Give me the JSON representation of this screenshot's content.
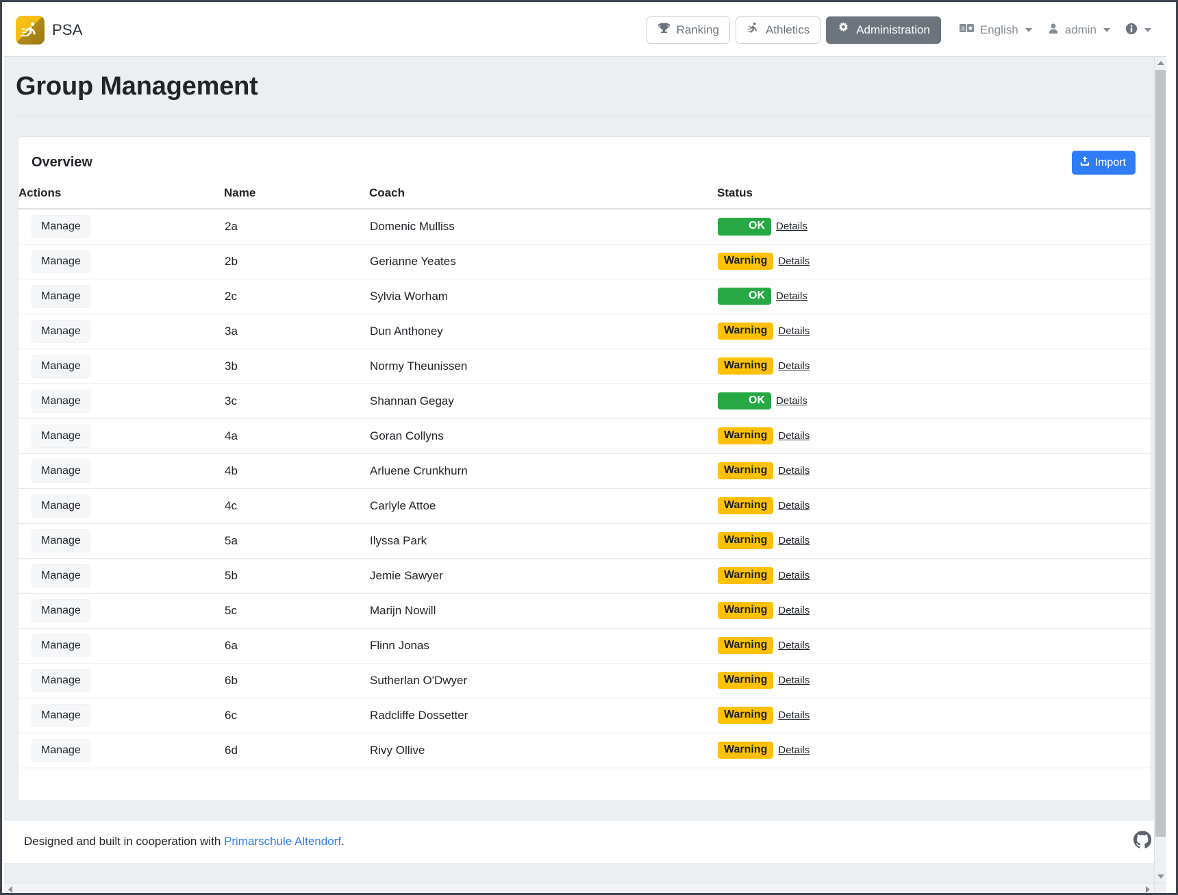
{
  "navbar": {
    "brand": "PSA",
    "brand_logo_icon": "runner-logo-icon",
    "primary_buttons": [
      {
        "label": "Ranking",
        "icon": "trophy-icon",
        "active": false
      },
      {
        "label": "Athletics",
        "icon": "runner-icon",
        "active": false
      },
      {
        "label": "Administration",
        "icon": "gear-icon",
        "active": true
      }
    ],
    "utilities": [
      {
        "label": "English",
        "icon": "translate-icon"
      },
      {
        "label": "admin",
        "icon": "person-icon"
      },
      {
        "label": "",
        "icon": "info-icon"
      }
    ]
  },
  "page": {
    "title": "Group Management"
  },
  "card": {
    "title": "Overview",
    "import_label": "Import",
    "import_icon": "upload-icon"
  },
  "table": {
    "columns": [
      "Actions",
      "Name",
      "Coach",
      "Status"
    ],
    "action_label": "Manage",
    "details_label": "Details",
    "rows": [
      {
        "name": "2a",
        "coach": "Domenic Mulliss",
        "status": "OK",
        "status_kind": "ok"
      },
      {
        "name": "2b",
        "coach": "Gerianne Yeates",
        "status": "Warning",
        "status_kind": "warning"
      },
      {
        "name": "2c",
        "coach": "Sylvia Worham",
        "status": "OK",
        "status_kind": "ok"
      },
      {
        "name": "3a",
        "coach": "Dun Anthoney",
        "status": "Warning",
        "status_kind": "warning"
      },
      {
        "name": "3b",
        "coach": "Normy Theunissen",
        "status": "Warning",
        "status_kind": "warning"
      },
      {
        "name": "3c",
        "coach": "Shannan Gegay",
        "status": "OK",
        "status_kind": "ok"
      },
      {
        "name": "4a",
        "coach": "Goran Collyns",
        "status": "Warning",
        "status_kind": "warning"
      },
      {
        "name": "4b",
        "coach": "Arluene Crunkhurn",
        "status": "Warning",
        "status_kind": "warning"
      },
      {
        "name": "4c",
        "coach": "Carlyle Attoe",
        "status": "Warning",
        "status_kind": "warning"
      },
      {
        "name": "5a",
        "coach": "Ilyssa Park",
        "status": "Warning",
        "status_kind": "warning"
      },
      {
        "name": "5b",
        "coach": "Jemie Sawyer",
        "status": "Warning",
        "status_kind": "warning"
      },
      {
        "name": "5c",
        "coach": "Marijn Nowill",
        "status": "Warning",
        "status_kind": "warning"
      },
      {
        "name": "6a",
        "coach": "Flinn Jonas",
        "status": "Warning",
        "status_kind": "warning"
      },
      {
        "name": "6b",
        "coach": "Sutherlan O'Dwyer",
        "status": "Warning",
        "status_kind": "warning"
      },
      {
        "name": "6c",
        "coach": "Radcliffe Dossetter",
        "status": "Warning",
        "status_kind": "warning"
      },
      {
        "name": "6d",
        "coach": "Rivy Ollive",
        "status": "Warning",
        "status_kind": "warning"
      }
    ]
  },
  "footer": {
    "text_before": "Designed and built in cooperation with ",
    "link_label": "Primarschule Altendorf",
    "text_after": ".",
    "github_icon": "github-icon"
  },
  "colors": {
    "accent": "#2f7cf6",
    "ok": "#28a745",
    "warning": "#ffc107",
    "active_nav": "#6c757d",
    "brand": "#f5c518"
  }
}
